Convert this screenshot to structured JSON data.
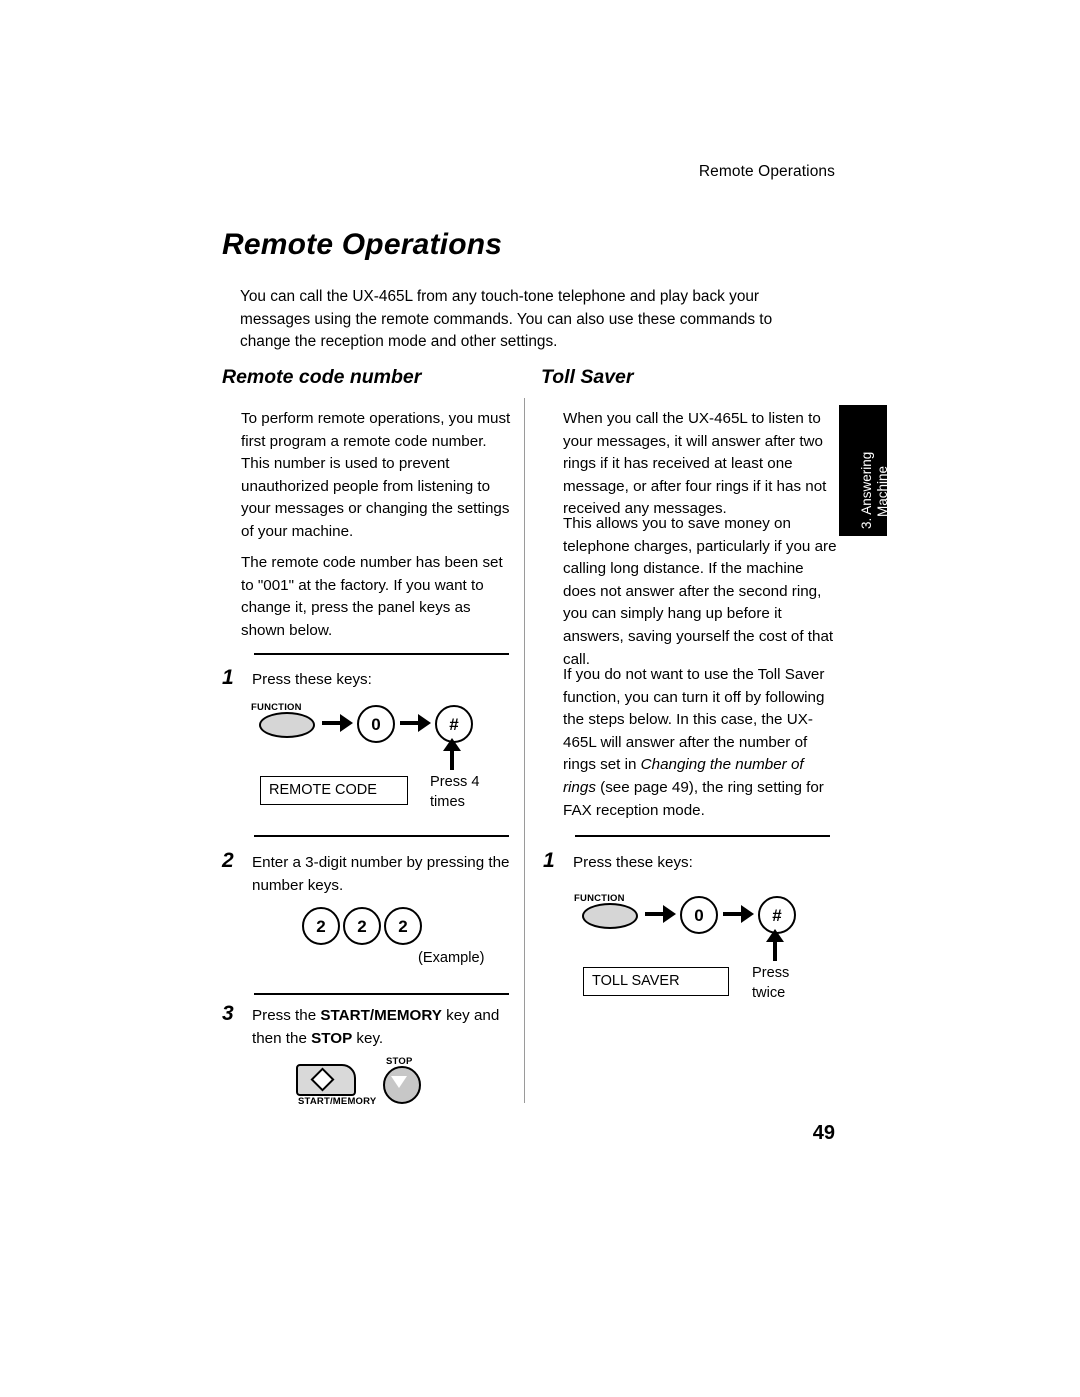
{
  "header": {
    "running_title": "Remote Operations",
    "page_number": "49"
  },
  "title": "Remote Operations",
  "intro": "You can call the UX-465L from any touch-tone telephone and play back your messages using the remote commands. You can also use these commands to change the reception mode and other settings.",
  "side_tab": {
    "line1": "3. Answering",
    "line2": "Machine"
  },
  "left_column": {
    "heading": "Remote code number",
    "paragraphs": [
      "To perform remote operations, you must first program a remote code number. This number is used to prevent unauthorized people from listening to your messages or changing the settings of your machine.",
      "The remote code number has been set to \"001\" at the factory. If you want to change it, press the panel keys as shown below."
    ],
    "steps": [
      {
        "number": "1",
        "text": "Press these keys:",
        "diagram": {
          "function_label": "FUNCTION",
          "key_0": "0",
          "key_hash": "#",
          "box_label": "REMOTE CODE",
          "caption": "Press 4 times"
        }
      },
      {
        "number": "2",
        "text": "Enter a 3-digit number by pressing the number keys.",
        "diagram": {
          "keys": [
            "2",
            "2",
            "2"
          ],
          "caption": "(Example)"
        }
      },
      {
        "number": "3",
        "text_parts": [
          "Press the ",
          "START/MEMORY",
          " key and then the ",
          "STOP",
          " key."
        ],
        "diagram": {
          "start_label": "START/MEMORY",
          "stop_label": "STOP"
        }
      }
    ]
  },
  "right_column": {
    "heading": "Toll Saver",
    "paragraphs": [
      "When you call the UX-465L to listen to your messages, it will answer after two rings if it has received at least one message, or after four rings if it has not received any messages.",
      "This allows you to save money on telephone charges, particularly if you are calling long distance. If the machine does not answer after the second ring, you can simply hang up before it answers, saving yourself the cost of that call."
    ],
    "paragraph3_parts": [
      "If you do not want to use the Toll Saver function, you can turn it off by following the steps below. In this case, the UX-465L will answer after the number of rings set in ",
      "Changing the number of rings",
      " (see page 49), the ring setting for FAX reception mode."
    ],
    "steps": [
      {
        "number": "1",
        "text": "Press these keys:",
        "diagram": {
          "function_label": "FUNCTION",
          "key_0": "0",
          "key_hash": "#",
          "box_label": "TOLL SAVER",
          "caption": "Press twice"
        }
      }
    ]
  }
}
